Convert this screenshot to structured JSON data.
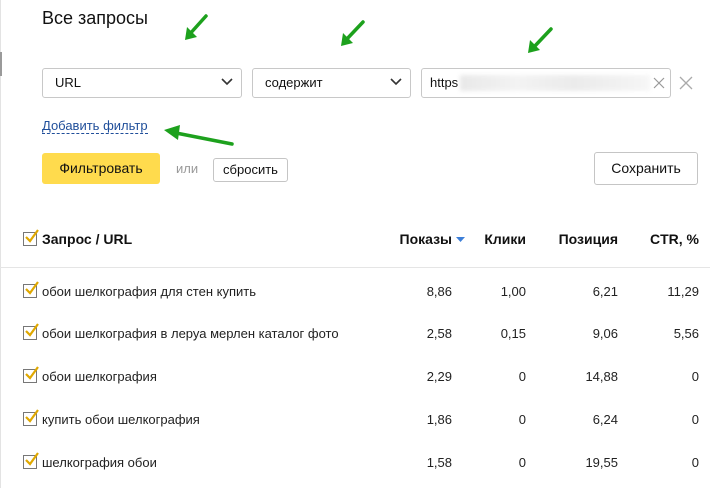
{
  "page": {
    "title": "Все запросы"
  },
  "filter": {
    "field": "URL",
    "operator": "содержит",
    "value": "https",
    "add_filter_label": "Добавить фильтр",
    "apply_label": "Фильтровать",
    "or_label": "или",
    "reset_label": "сбросить",
    "save_label": "Сохранить"
  },
  "table": {
    "columns": [
      "Запрос / URL",
      "Показы",
      "Клики",
      "Позиция",
      "CTR, %"
    ],
    "sort_column": "Показы",
    "rows": [
      {
        "query": "обои шелкография для стен купить",
        "shows": "8,86",
        "clicks": "1,00",
        "position": "6,21",
        "ctr": "11,29"
      },
      {
        "query": "обои шелкография в леруа мерлен каталог фото",
        "shows": "2,58",
        "clicks": "0,15",
        "position": "9,06",
        "ctr": "5,56"
      },
      {
        "query": "обои шелкография",
        "shows": "2,29",
        "clicks": "0",
        "position": "14,88",
        "ctr": "0"
      },
      {
        "query": "купить обои шелкография",
        "shows": "1,86",
        "clicks": "0",
        "position": "6,24",
        "ctr": "0"
      },
      {
        "query": "шелкография обои",
        "shows": "1,58",
        "clicks": "0",
        "position": "19,55",
        "ctr": "0"
      }
    ]
  },
  "colors": {
    "primary_button": "#ffdb4d",
    "link": "#1f4e9a",
    "checkbox_tick": "#e0a800",
    "annotation_arrow": "#1da11d"
  }
}
